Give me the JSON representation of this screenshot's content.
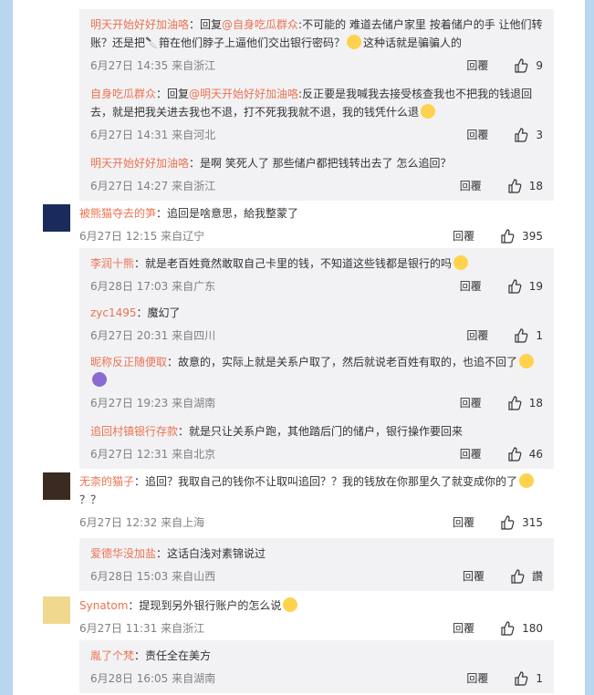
{
  "comments": [
    {
      "type": "reply",
      "user": "明天开始好好加油咯",
      "text_parts": [
        "：回复",
        "@自身吃瓜群众",
        ":不可能的 难道去储户家里 按着储户的手 让他们转账？还是把",
        "箝在他们脖子上逼他们交出银行密码？",
        "这种话就是骗骗人的"
      ],
      "time": "6月27日 14:35 来自浙江",
      "reply": "回覆",
      "likes": "9"
    },
    {
      "type": "reply",
      "user": "自身吃瓜群众",
      "text_parts": [
        "：回复",
        "@明天开始好好加油咯",
        ":反正要是我喊我去接受核查我也不把我的钱退回去，就是把我关进去我也不退，打不死我我就不退，我的钱凭什么退"
      ],
      "time": "6月27日 14:31 来自河北",
      "reply": "回覆",
      "likes": "3"
    },
    {
      "type": "reply",
      "user": "明天开始好好加油咯",
      "text_parts": [
        "：是啊 笑死人了 那些储户都把钱转出去了 怎么追回？"
      ],
      "time": "6月27日 14:27 来自浙江",
      "reply": "回覆",
      "likes": "18"
    },
    {
      "type": "top",
      "user": "被熊猫夺去的笋",
      "text_parts": [
        "：追回是啥意思，給我整蒙了"
      ],
      "time": "6月27日 12:15 来自辽宁",
      "reply": "回覆",
      "likes": "395"
    },
    {
      "type": "reply",
      "user": "李润十熊",
      "text_parts": [
        "：就是老百姓竟然敢取自己卡里的钱，不知道这些钱都是银行的吗"
      ],
      "time": "6月28日 17:03 来自广东",
      "reply": "回覆",
      "likes": "19"
    },
    {
      "type": "reply",
      "user": "zyc1495",
      "text_parts": [
        "：魔幻了"
      ],
      "time": "6月27日 20:31 来自四川",
      "reply": "回覆",
      "likes": "1"
    },
    {
      "type": "reply",
      "user": "昵称反正随便取",
      "text_parts": [
        "：故意的，实际上就是关系户取了，然后就说老百姓有取的，也追不回了"
      ],
      "time": "6月27日 19:23 来自湖南",
      "reply": "回覆",
      "likes": "18"
    },
    {
      "type": "reply",
      "user": "追回村镇银行存款",
      "text_parts": [
        "：就是只让关系户跑，其他踏后门的储户，银行操作要回来"
      ],
      "time": "6月27日 12:31 来自北京",
      "reply": "回覆",
      "likes": "46"
    },
    {
      "type": "top",
      "user": "无柰的猫子",
      "text_parts": [
        "：追回？我取自己的钱你不让取叫追回？？我的钱放在你那里久了就变成你的了",
        "？？"
      ],
      "time": "6月27日 12:32 来自上海",
      "reply": "回覆",
      "likes": "315"
    },
    {
      "type": "reply",
      "user": "爱德华没加盐",
      "text_parts": [
        "：这话白浅对素锦说过"
      ],
      "time": "6月28日 15:03 来自山西",
      "reply": "回覆",
      "likes": "讚"
    },
    {
      "type": "top",
      "user": "Synatom",
      "text_parts": [
        "：提现到另外银行账户的怎么说"
      ],
      "time": "6月27日 11:31 来自浙江",
      "reply": "回覆",
      "likes": "180"
    },
    {
      "type": "reply",
      "user": "胤了个梵",
      "text_parts": [
        "：责任全在美方"
      ],
      "time": "6月28日 16:05 来自湖南",
      "reply": "回覆",
      "likes": "1"
    }
  ],
  "colors": {
    "username": "#eb7350",
    "background": "#b8d6ee",
    "reply_bg": "#f2f2f5"
  }
}
